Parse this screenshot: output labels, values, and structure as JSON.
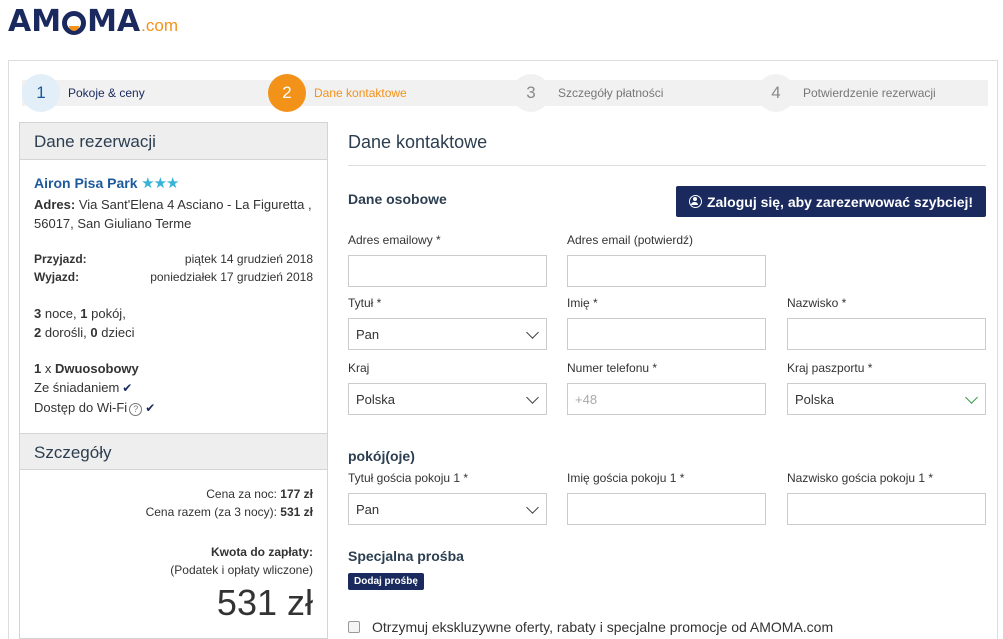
{
  "logo": {
    "brand_left": "AM",
    "brand_right": "MA",
    "tld": ".com"
  },
  "steps": [
    {
      "num": "1",
      "label": "Pokoje & ceny"
    },
    {
      "num": "2",
      "label": "Dane kontaktowe"
    },
    {
      "num": "3",
      "label": "Szczegóły płatności"
    },
    {
      "num": "4",
      "label": "Potwierdzenie rezerwacji"
    }
  ],
  "sidebar": {
    "title": "Dane rezerwacji",
    "hotel_name": "Airon Pisa Park",
    "stars": "★★★",
    "address_label": "Adres:",
    "address": "Via Sant'Elena 4 Asciano - La Figuretta , 56017, San Giuliano Terme",
    "checkin_label": "Przyjazd:",
    "checkin": "piątek 14 grudzień 2018",
    "checkout_label": "Wyjazd:",
    "checkout": "poniedziałek 17 grudzień 2018",
    "nights_num": "3",
    "nights_text": " noce, ",
    "rooms_num": "1",
    "rooms_text": " pokój,",
    "adults_num": "2",
    "adults_text": " dorośli, ",
    "children_num": "0",
    "children_text": " dzieci",
    "room_qty": "1",
    "room_x": " x ",
    "room_type": "Dwuosobowy",
    "breakfast": "Ze śniadaniem",
    "wifi": "Dostęp do Wi-Fi",
    "details_title": "Szczegóły",
    "price_night_label": "Cena za noc:",
    "price_night": "177 zł",
    "price_total_label": "Cena razem (za 3 nocy):",
    "price_total": "531 zł",
    "pay_label": "Kwota do zapłaty:",
    "pay_note": "(Podatek i opłaty wliczone)",
    "pay_amount": "531 zł"
  },
  "form": {
    "title": "Dane kontaktowe",
    "personal_title": "Dane osobowe",
    "login_button": "Zaloguj się, aby zarezerwować szybciej!",
    "email_label": "Adres emailowy *",
    "email_value": "",
    "email_confirm_label": "Adres email (potwierdź)",
    "email_confirm_value": "",
    "title_label": "Tytuł *",
    "title_value": "Pan",
    "firstname_label": "Imię *",
    "firstname_value": "",
    "lastname_label": "Nazwisko *",
    "lastname_value": "",
    "country_label": "Kraj",
    "country_value": "Polska",
    "phone_label": "Numer telefonu *",
    "phone_placeholder": "+48",
    "passport_label": "Kraj paszportu *",
    "passport_value": "Polska",
    "rooms_title": "pokój(oje)",
    "guest_title_label": "Tytuł gościa pokoju 1 *",
    "guest_title_value": "Pan",
    "guest_first_label": "Imię gościa pokoju 1 *",
    "guest_first_value": "",
    "guest_last_label": "Nazwisko gościa pokoju 1 *",
    "guest_last_value": "",
    "special_title": "Specjalna prośba",
    "add_request_button": "Dodaj prośbę",
    "offers_label": "Otrzymuj ekskluzywne oferty, rabaty i specjalne promocje od AMOMA.com"
  }
}
